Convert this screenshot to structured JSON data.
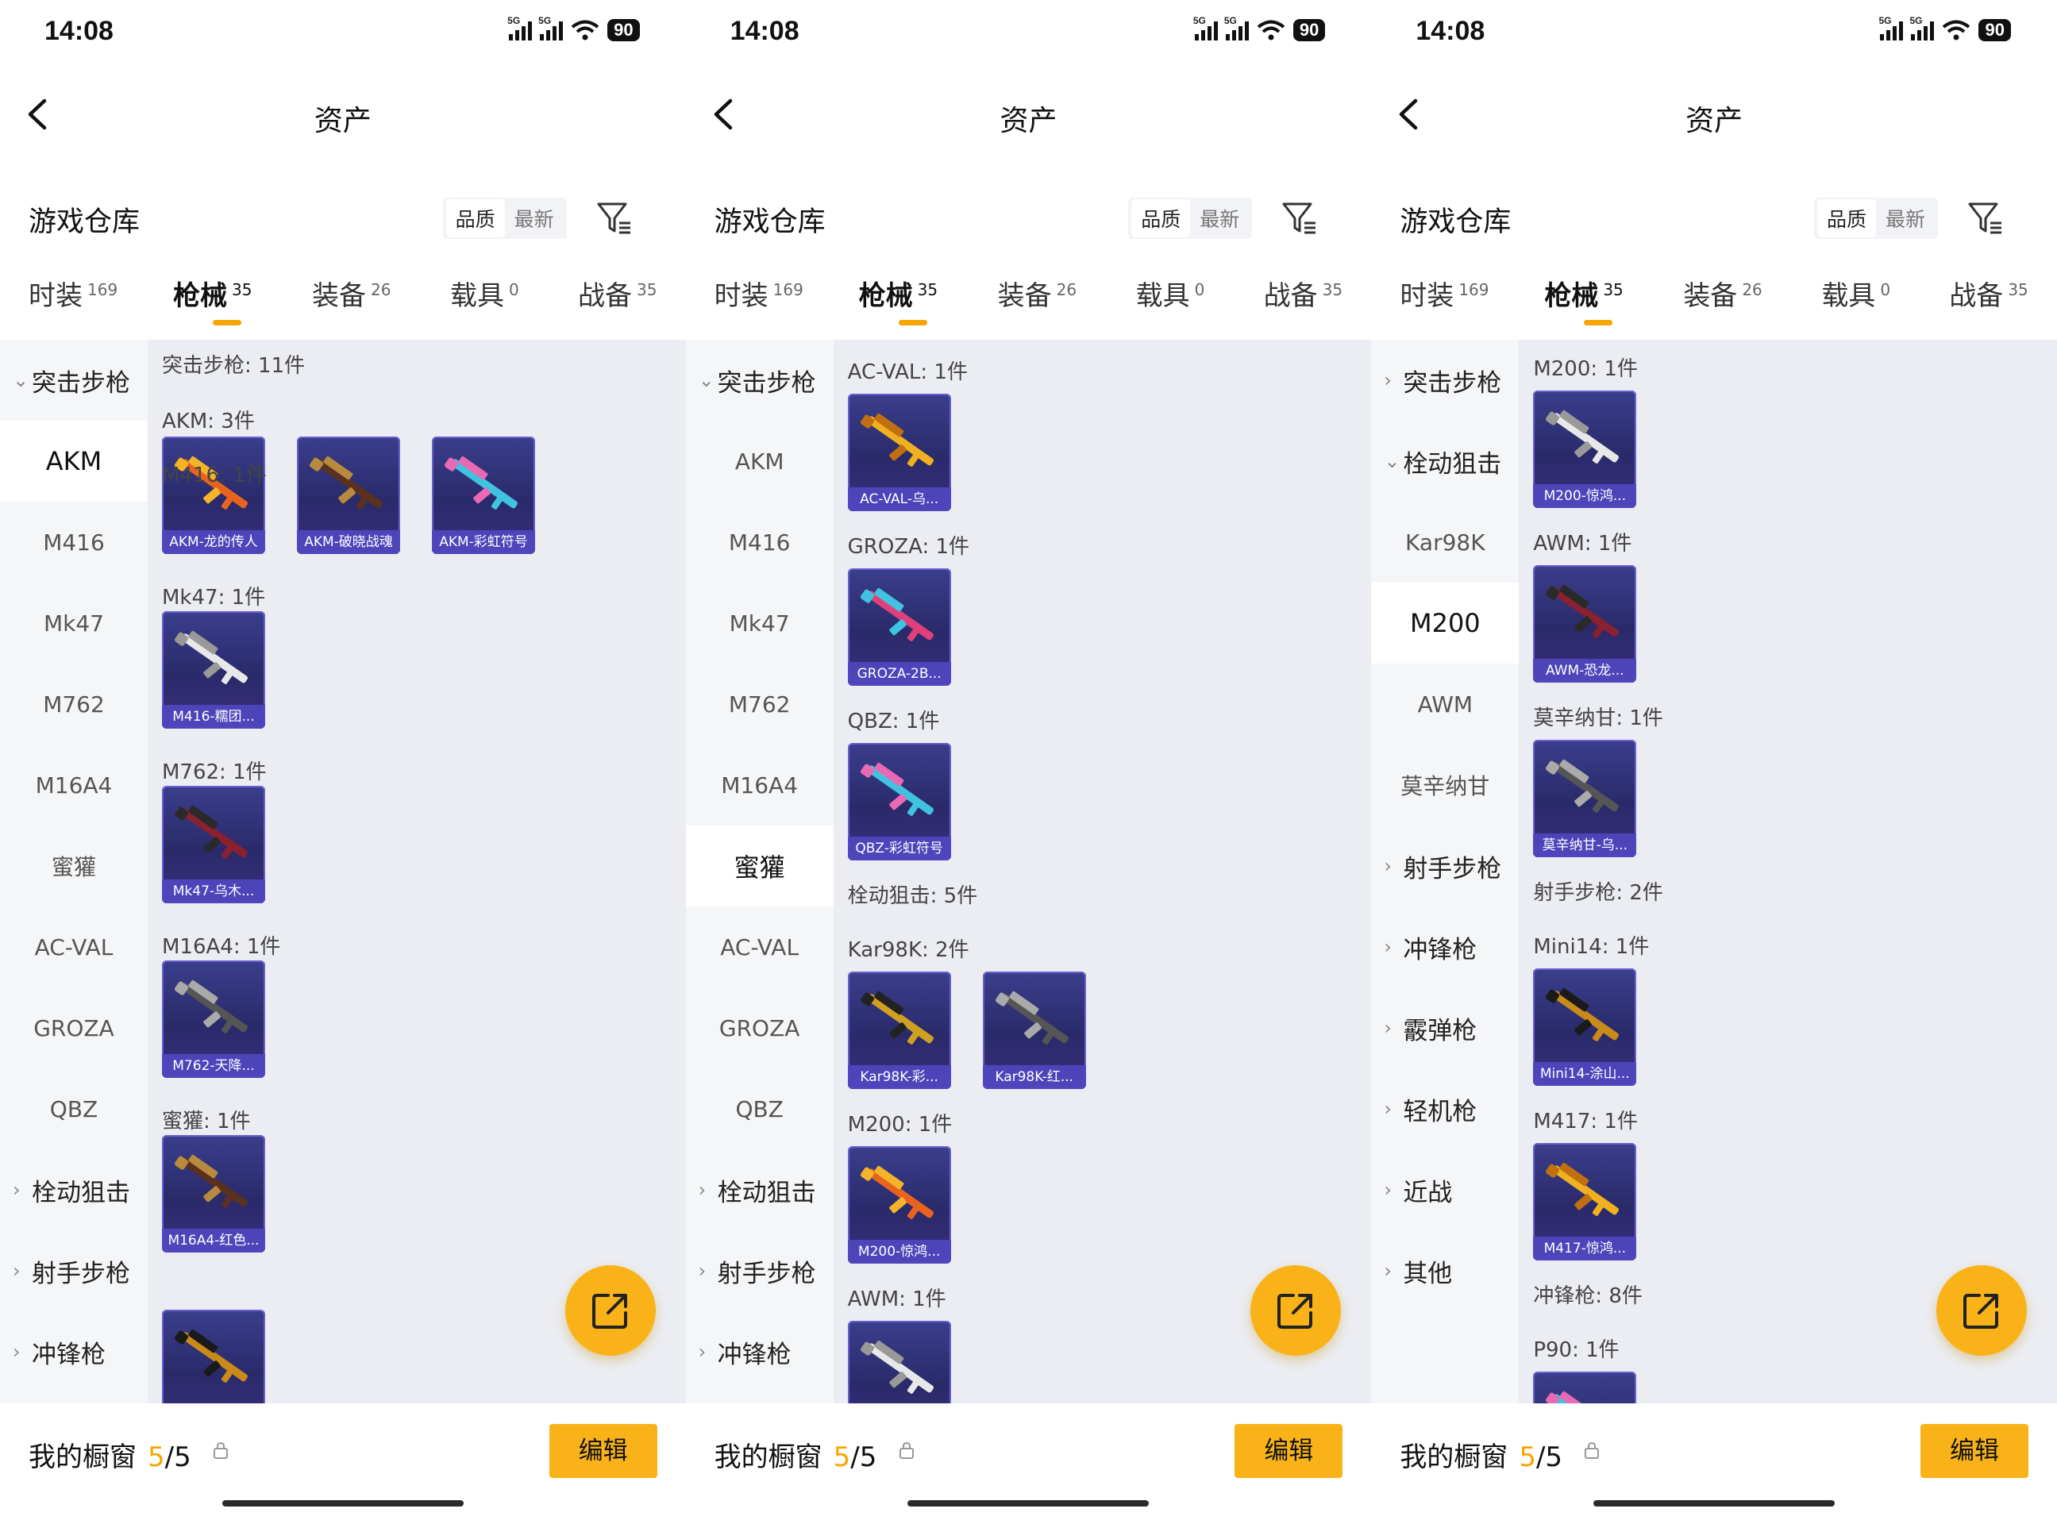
{
  "status": {
    "time": "14:08",
    "net1": "5G",
    "net2": "5G",
    "battery": "90"
  },
  "nav": {
    "title": "资产"
  },
  "section": {
    "title": "游戏仓库",
    "sort_quality": "品质",
    "sort_newest": "最新"
  },
  "tabs": [
    {
      "label": "时装",
      "count": "169"
    },
    {
      "label": "枪械",
      "count": "35"
    },
    {
      "label": "装备",
      "count": "26"
    },
    {
      "label": "载具",
      "count": "0"
    },
    {
      "label": "战备",
      "count": "35"
    }
  ],
  "bottom": {
    "label": "我的橱窗",
    "count_num": "5",
    "count_total": "/5",
    "edit": "编辑"
  },
  "colors": {
    "accent": "#f9b318",
    "card_bg": "#2a2a6a",
    "card_caption": "#5046be"
  },
  "panels": [
    {
      "sidebar": [
        "突击步枪",
        "AKM",
        "M416",
        "Mk47",
        "M762",
        "M16A4",
        "蜜獾",
        "AC-VAL",
        "GROZA",
        "QBZ",
        "栓动狙击",
        "射手步枪",
        "冲锋枪"
      ],
      "content": {
        "category_header": "突击步枪: 11件",
        "groups": [
          {
            "label": "AKM: 3件",
            "cards": [
              "AKM-龙的传人",
              "AKM-破晓战魂",
              "AKM-彩虹符号"
            ]
          },
          {
            "label": "M416: 1件",
            "cards": [
              "M416-糯团..."
            ]
          },
          {
            "label": "Mk47: 1件",
            "cards": [
              "Mk47-乌木..."
            ]
          },
          {
            "label": "M762: 1件",
            "cards": [
              "M762-天降..."
            ]
          },
          {
            "label": "M16A4: 1件",
            "cards": [
              "M16A4-红色..."
            ]
          },
          {
            "label": "蜜獾: 1件",
            "cards": [
              ""
            ]
          }
        ]
      }
    },
    {
      "sidebar": [
        "突击步枪",
        "AKM",
        "M416",
        "Mk47",
        "M762",
        "M16A4",
        "蜜獾",
        "AC-VAL",
        "GROZA",
        "QBZ",
        "栓动狙击",
        "射手步枪",
        "冲锋枪"
      ],
      "content": {
        "groups": [
          {
            "label": "AC-VAL: 1件",
            "cards": [
              "AC-VAL-乌..."
            ]
          },
          {
            "label": "GROZA: 1件",
            "cards": [
              "GROZA-2B..."
            ]
          },
          {
            "label": "QBZ: 1件",
            "cards": [
              "QBZ-彩虹符号"
            ]
          },
          {
            "label": "栓动狙击: 5件",
            "cards": []
          },
          {
            "label": "Kar98K: 2件",
            "cards": [
              "Kar98K-彩...",
              "Kar98K-红..."
            ]
          },
          {
            "label": "M200: 1件",
            "cards": [
              "M200-惊鸿..."
            ]
          },
          {
            "label": "AWM: 1件",
            "cards": [
              ""
            ]
          }
        ]
      }
    },
    {
      "sidebar": [
        "突击步枪",
        "栓动狙击",
        "Kar98K",
        "M200",
        "AWM",
        "莫辛纳甘",
        "射手步枪",
        "冲锋枪",
        "霰弹枪",
        "轻机枪",
        "近战",
        "其他"
      ],
      "content": {
        "groups": [
          {
            "label": "M200: 1件",
            "cards": [
              "M200-惊鸿..."
            ]
          },
          {
            "label": "AWM: 1件",
            "cards": [
              "AWM-恐龙..."
            ]
          },
          {
            "label": "莫辛纳甘: 1件",
            "cards": [
              "莫辛纳甘-乌..."
            ]
          },
          {
            "label": "射手步枪: 2件",
            "cards": []
          },
          {
            "label": "Mini14: 1件",
            "cards": [
              "Mini14-涂山..."
            ]
          },
          {
            "label": "M417: 1件",
            "cards": [
              "M417-惊鸿..."
            ]
          },
          {
            "label": "冲锋枪: 8件",
            "cards": []
          },
          {
            "label": "P90: 1件",
            "cards": [
              ""
            ]
          }
        ]
      }
    }
  ]
}
